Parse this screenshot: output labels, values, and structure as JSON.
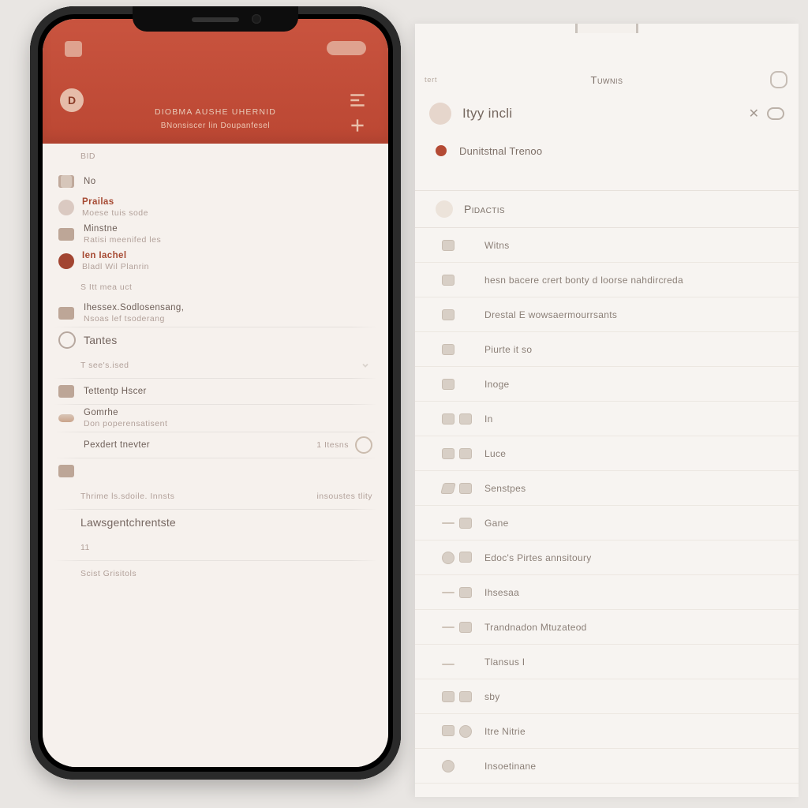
{
  "colors": {
    "accent": "#bb4733"
  },
  "phone": {
    "header": {
      "badge": "D",
      "line1": "DIOBMA AUSHE   UHERNID",
      "line2": "BNonsiscer lin Doupanfesel"
    },
    "sections": [
      {
        "type": "label",
        "text": "BID"
      },
      {
        "type": "item",
        "icon": "bar",
        "title": "No"
      },
      {
        "type": "item",
        "icon": "dot",
        "title": "Prailas",
        "accent": true,
        "sub": "Moese tuis sode"
      },
      {
        "type": "item",
        "icon": "slab",
        "title": "Minstne",
        "outlined": true,
        "sub": "Ratisi meenifed les"
      },
      {
        "type": "item",
        "icon": "reddot",
        "title": "Ien Iachel",
        "accent": true,
        "sub": "Bladl Wil Planrin"
      },
      {
        "type": "label",
        "text": "S Itt mea uct"
      },
      {
        "type": "item",
        "icon": "slab",
        "title": "Ihessex.Sodlosensang,",
        "sub": "Nsoas lef tsoderang"
      },
      {
        "type": "sep"
      },
      {
        "type": "item",
        "icon": "o",
        "title": "Tantes",
        "big": true
      },
      {
        "type": "label",
        "text": "T see's.ised",
        "chev": true
      },
      {
        "type": "sep"
      },
      {
        "type": "item",
        "icon": "slab",
        "title": "Tettentp Hscer"
      },
      {
        "type": "sep"
      },
      {
        "type": "item",
        "icon": "wave",
        "title": "Gomrhe",
        "sub": "Don poperensatisent"
      },
      {
        "type": "sep"
      },
      {
        "type": "item",
        "icon": "none",
        "title": "Pexdert tnevter",
        "trail": "1 Itesns",
        "trailglyph": true
      },
      {
        "type": "sep"
      },
      {
        "type": "item",
        "icon": "slab",
        "title": ""
      },
      {
        "type": "label",
        "text": "Thrime ls.sdoile. Innsts",
        "trail": "insoustes tlity"
      },
      {
        "type": "sep"
      },
      {
        "type": "label",
        "text": "Lawsgentchrentste",
        "big": true
      },
      {
        "type": "label",
        "text": "11"
      },
      {
        "type": "sep"
      },
      {
        "type": "label",
        "text": "Scist  Grisitols"
      }
    ]
  },
  "panel": {
    "tab_left": "tert",
    "title": "Tuwnis",
    "row_title": "Ityy incli",
    "sub": "Dunitstnal Trenoo",
    "section": "Pidactis",
    "items": [
      "Witns",
      "hesn bacere crert bonty d loorse nahdircreda",
      "Drestal E wowsaermourrsants",
      "Piurte it so",
      "Inoge",
      "In",
      "Luce",
      "Senstpes",
      "Gane",
      "Edoc's Pirtes annsitoury",
      "Ihsesaa",
      "Trandnadon Mtuzateod",
      "Tlansus I",
      "sby",
      "Itre Nitrie",
      "Insoetinane"
    ]
  }
}
